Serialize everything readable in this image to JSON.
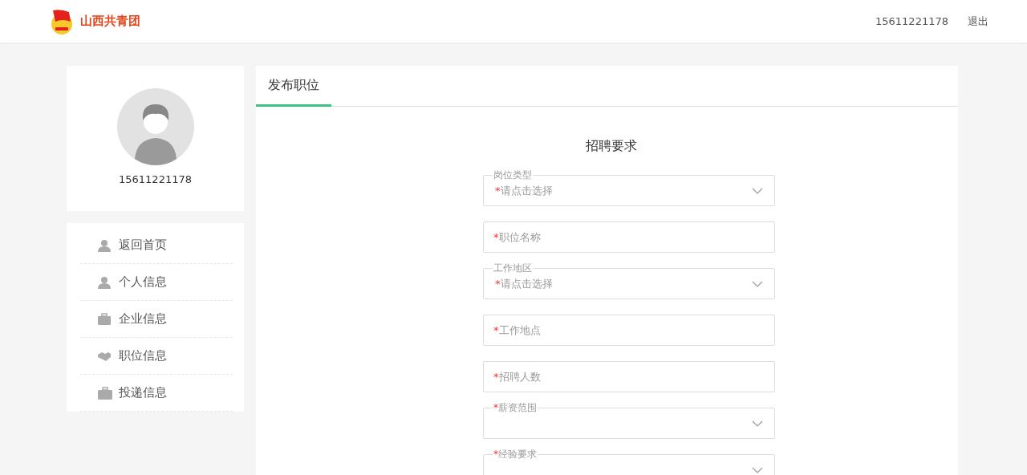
{
  "header": {
    "brand": "山西共青团",
    "user": "15611221178",
    "logout": "退出"
  },
  "profile": {
    "name": "15611221178"
  },
  "menu": [
    {
      "label": "返回首页"
    },
    {
      "label": "个人信息"
    },
    {
      "label": "企业信息"
    },
    {
      "label": "职位信息"
    },
    {
      "label": "投递信息"
    }
  ],
  "tabs": [
    {
      "label": "发布职位",
      "selected": true
    }
  ],
  "form": {
    "title": "招聘要求",
    "fields": [
      {
        "kind": "select",
        "label": "岗位类型",
        "mark": "*",
        "placeholder": "请点击选择"
      },
      {
        "kind": "text",
        "mark": "*",
        "placeholder": "职位名称"
      },
      {
        "kind": "select",
        "label": "工作地区",
        "mark": "*",
        "placeholder": "请点击选择"
      },
      {
        "kind": "text",
        "mark": "*",
        "placeholder": "工作地点"
      },
      {
        "kind": "text",
        "mark": "*",
        "placeholder": "招聘人数"
      },
      {
        "kind": "select-labeled",
        "mark": "*",
        "label": "薪资范围"
      },
      {
        "kind": "select-labeled",
        "mark": "*",
        "label": "经验要求"
      }
    ]
  }
}
